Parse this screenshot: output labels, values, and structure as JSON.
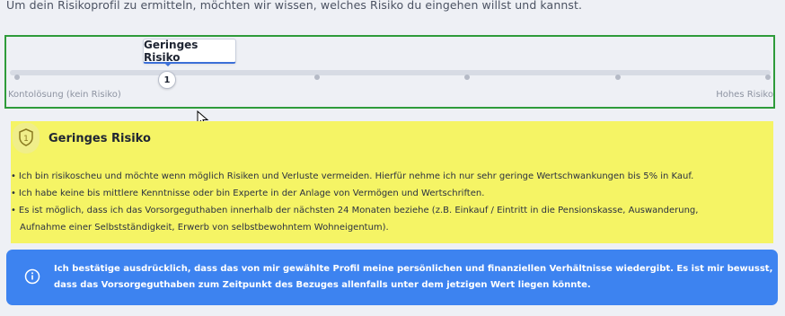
{
  "intro_text": "Um dein Risikoprofil zu ermitteln, möchten wir wissen, welches Risiko du eingehen willst und kannst.",
  "slider": {
    "selected_label": "Geringes Risiko",
    "selected_value": "1",
    "min_label": "Kontolösung (kein Risiko)",
    "max_label": "Hohes Risiko",
    "steps": 6,
    "selected_step": 1
  },
  "risk_card": {
    "title": "Geringes Risiko",
    "badge_number": "1",
    "bullets": [
      "Ich bin risikoscheu und möchte wenn möglich Risiken und Verluste vermeiden. Hierfür nehme ich nur sehr geringe Wertschwankungen bis 5% in Kauf.",
      "Ich habe keine bis mittlere Kenntnisse oder bin Experte in der Anlage von Vermögen und Wertschriften.",
      "Es ist möglich, dass ich das Vorsorgeguthaben innerhalb der nächsten 24 Monaten beziehe (z.B. Einkauf / Eintritt in die Pensionskasse, Auswanderung,"
    ],
    "bullet_continuation": "Aufnahme einer Selbstständigkeit, Erwerb von selbstbewohntem Wohneigentum).",
    "background_color": "#f5f465"
  },
  "info_banner": {
    "line1": "Ich bestätige ausdrücklich, dass das von mir gewählte Profil meine persönlichen und finanziellen Verhältnisse wiedergibt. Es ist mir bewusst,",
    "line2": "dass das Vorsorgeguthaben zum Zeitpunkt des Bezuges allenfalls unter dem jetzigen Wert liegen könnte.",
    "icon": "info-icon",
    "background_color": "#3d83f0"
  }
}
